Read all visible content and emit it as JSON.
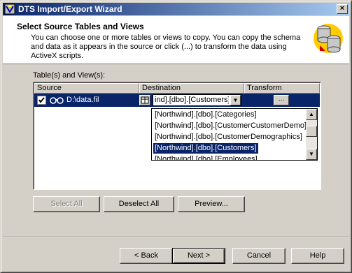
{
  "window": {
    "title": "DTS Import/Export Wizard",
    "close_glyph": "×"
  },
  "header": {
    "heading": "Select Source Tables and Views",
    "description": "You can choose one or more tables or views to copy.  You can copy the schema and data as it appears in the source or click (...) to transform the data using ActiveX scripts."
  },
  "grid": {
    "label": "Table(s) and View(s):",
    "columns": [
      "Source",
      "Destination",
      "Transform"
    ],
    "row": {
      "checked": true,
      "source": "D:\\data.fil",
      "destination": "ind].[dbo].[Customers]",
      "transform_label": "..."
    }
  },
  "dropdown": {
    "items": [
      "[Northwind].[dbo].[Categories]",
      "[Northwind].[dbo].[CustomerCustomerDemo]",
      "[Northwind].[dbo].[CustomerDemographics]",
      "[Northwind].[dbo].[Customers]",
      "[Northwind].[dbo].[Employees]"
    ],
    "selected": "[Northwind].[dbo].[Customers]"
  },
  "actions": {
    "select_all": "Select All",
    "deselect_all": "Deselect All",
    "preview": "Preview..."
  },
  "footer": {
    "back": "< Back",
    "next": "Next >",
    "cancel": "Cancel",
    "help": "Help"
  },
  "colors": {
    "selection": "#0a246a",
    "face": "#d4d0c8"
  }
}
